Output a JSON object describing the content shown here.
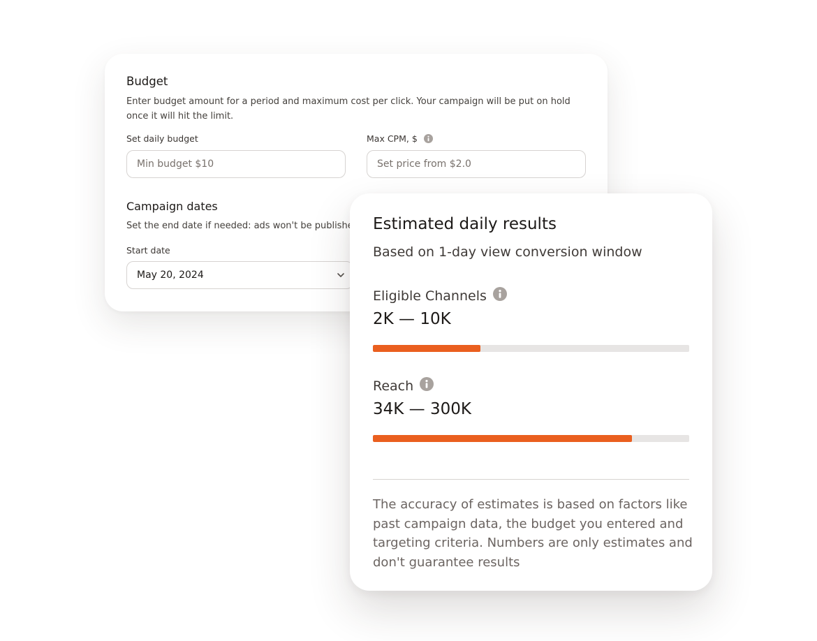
{
  "budget": {
    "title": "Budget",
    "description": "Enter budget amount for a period and maximum cost per click. Your campaign will be put on hold once it will hit the limit.",
    "daily_budget_label": "Set daily budget",
    "daily_budget_placeholder": "Min budget $10",
    "max_cpm_label": "Max CPM, $",
    "max_cpm_placeholder": "Set price from $2.0"
  },
  "campaign_dates": {
    "title": "Campaign dates",
    "description": "Set the end date if needed: ads won't be publishe",
    "start_date_label": "Start date",
    "start_date_value": "May 20, 2024"
  },
  "estimates": {
    "title": "Estimated daily results",
    "subtitle": "Based on 1-day view conversion window",
    "metrics": [
      {
        "label": "Eligible Channels",
        "value": "2K — 10K",
        "progress": 0.34
      },
      {
        "label": "Reach",
        "value": "34K — 300K",
        "progress": 0.82
      }
    ],
    "note": "The accuracy of estimates is based on factors like past campaign data, the budget you entered and targeting criteria. Numbers are only estimates and don't guarantee results"
  },
  "colors": {
    "accent": "#ea5f1f",
    "track": "#e7e5e4",
    "info_icon": "#a8a29e"
  },
  "icons": {
    "info": "info-icon",
    "dropdown": "chevron-down-icon"
  }
}
